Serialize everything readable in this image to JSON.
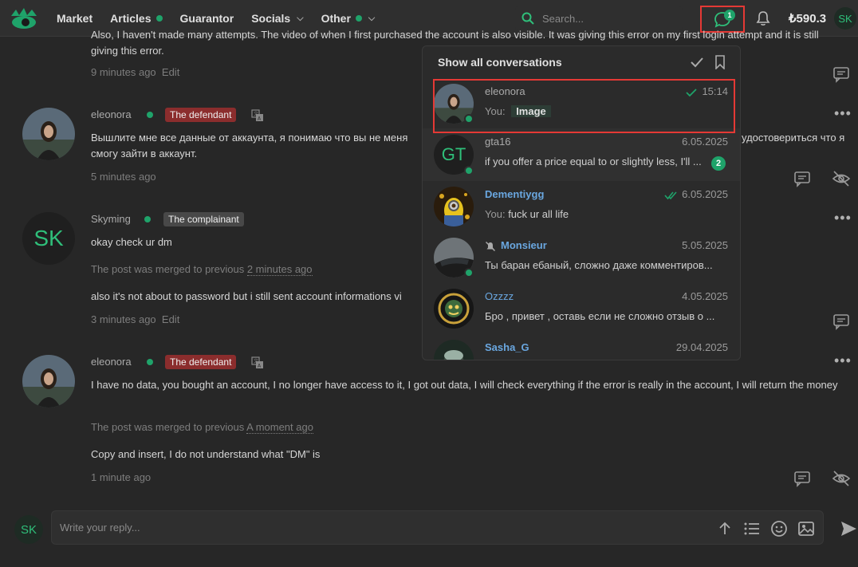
{
  "nav": {
    "items": [
      {
        "label": "Market",
        "dot": false,
        "chevron": false
      },
      {
        "label": "Articles",
        "dot": true,
        "chevron": false
      },
      {
        "label": "Guarantor",
        "dot": false,
        "chevron": false
      },
      {
        "label": "Socials",
        "dot": false,
        "chevron": true
      },
      {
        "label": "Other",
        "dot": true,
        "chevron": true
      }
    ],
    "search_placeholder": "Search...",
    "chat_badge": "1",
    "balance": "₺590.3",
    "user_initials": "SK"
  },
  "posts": {
    "p0": {
      "text": "Also, I haven't made many attempts. The video of when I first purchased the account is also visible. It was giving this error on my first login attempt and it is still giving this error.",
      "time": "9 minutes ago",
      "edit": "Edit"
    },
    "p1": {
      "user": "eleonora",
      "tag": "The defendant",
      "text": "Вышлите мне все данные от аккаунта, я понимаю что вы не меня… удостовериться что я смогу зайти в аккаунт.",
      "text_line1": "Вышлите мне все данные от аккаунта, я понимаю что вы не меня",
      "text_line1_tail": "удостовериться что я",
      "text_line2": "смогу зайти в аккаунт.",
      "time": "5 minutes ago"
    },
    "p2": {
      "user": "Skyming",
      "tag": "The complainant",
      "initials": "SK",
      "text": "okay check ur dm",
      "merged_prefix": "The post was merged to previous",
      "merged_time": "2 minutes ago",
      "text2": "also it's not about to password but i still sent account informations vi",
      "time": "3 minutes ago",
      "edit": "Edit"
    },
    "p3": {
      "user": "eleonora",
      "tag": "The defendant",
      "text": "I have no data, you bought an account, I no longer have access to it, I got out data, I will check everything if the error is really in the account, I will return the money",
      "merged_prefix": "The post was merged to previous",
      "merged_time": "A moment ago",
      "text2": "Copy and insert, I do not understand what \"DM\" is",
      "time": "1 minute ago"
    }
  },
  "dropdown": {
    "header": "Show all conversations",
    "conversations": [
      {
        "name": "eleonora",
        "time": "15:14",
        "prefix": "You:",
        "message": "Image"
      },
      {
        "name": "gta16",
        "initials": "GT",
        "time": "6.05.2025",
        "message": "if you offer a price equal to or slightly less, I'll ...",
        "unread": "2"
      },
      {
        "name": "Dementiygg",
        "time": "6.05.2025",
        "prefix": "You:",
        "message": "fuck ur all life"
      },
      {
        "name": "Monsieur",
        "time": "5.05.2025",
        "message": "Ты баран ебаный, сложно даже комментиров..."
      },
      {
        "name": "Ozzzz",
        "time": "4.05.2025",
        "message": "Бро , привет , оставь если не сложно отзыв о ..."
      },
      {
        "name": "Sasha_G",
        "time": "29.04.2025",
        "message": ""
      }
    ]
  },
  "reply": {
    "placeholder": "Write your reply...",
    "initials": "SK"
  },
  "colors": {
    "accent": "#1fa36a",
    "defendant": "#8b2d2d",
    "highlight": "#e53935",
    "link_blue": "#6aa7e0"
  }
}
